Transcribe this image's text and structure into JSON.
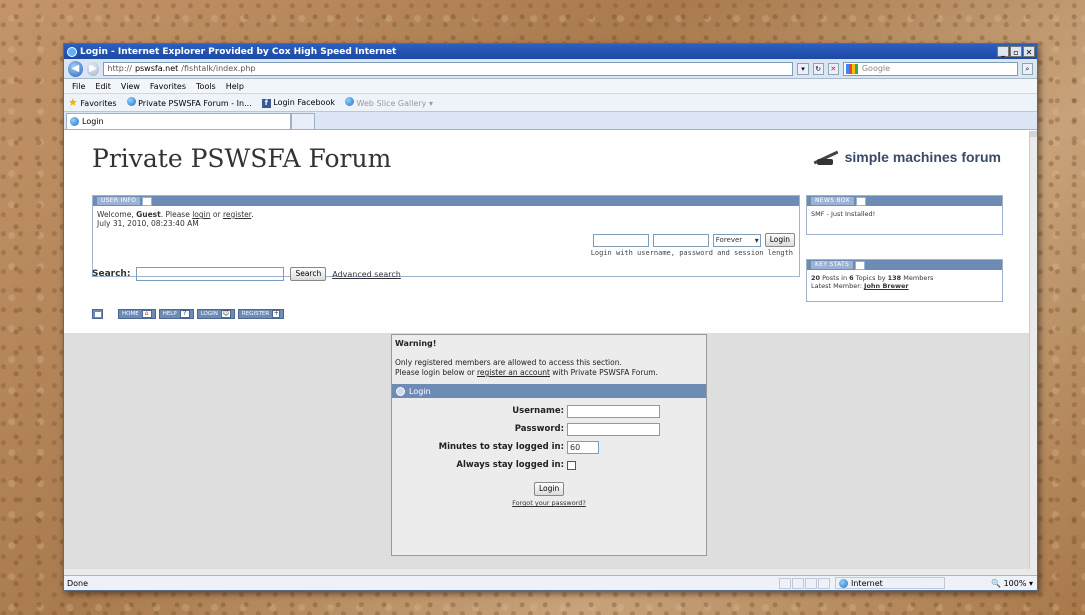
{
  "browser": {
    "title": "Login - Internet Explorer Provided by Cox High Speed Internet",
    "url_prefix": "http://",
    "url_host": "pswsfa.net",
    "url_path": "/fishtalk/index.php",
    "search_placeholder": "Google",
    "menu": [
      "File",
      "Edit",
      "View",
      "Favorites",
      "Tools",
      "Help"
    ],
    "favorites_label": "Favorites",
    "fav_links": [
      "Private PSWSFA Forum - In...",
      "Login Facebook",
      "Web Slice Gallery"
    ],
    "tab_title": "Login",
    "status_text": "Done",
    "zone": "Internet",
    "zoom": "100%"
  },
  "forum": {
    "title": "Private PSWSFA Forum",
    "logo_text": "simple machines forum",
    "user_info_label": "USER INFO",
    "welcome_prefix": "Welcome, ",
    "guest": "Guest",
    "welcome_mid": ". Please ",
    "login_link": "login",
    "or": " or ",
    "register_link": "register",
    "period": ".",
    "datetime": "July 31, 2010, 08:23:40 AM",
    "forever_option": "Forever",
    "login_button": "Login",
    "login_hint": "Login with username, password and session length",
    "search_label": "Search:",
    "search_button": "Search",
    "advanced_search": "Advanced search",
    "nav": [
      "HOME",
      "HELP",
      "LOGIN",
      "REGISTER"
    ],
    "news_label": "NEWS BOX",
    "news_text": "SMF - Just Installed!",
    "stats_label": "KEY STATS",
    "stats_posts": "20",
    "stats_t1": " Posts in ",
    "stats_topics": "6",
    "stats_t2": " Topics by ",
    "stats_members": "138",
    "stats_t3": " Members",
    "latest_member_label": "Latest Member: ",
    "latest_member": "John Brewer"
  },
  "login_box": {
    "warning_title": "Warning!",
    "warning_line1": "Only registered members are allowed to access this section.",
    "warning_line2a": "Please login below or ",
    "register_account": "register an account",
    "warning_line2b": " with Private PSWSFA Forum.",
    "header": "Login",
    "username_label": "Username:",
    "password_label": "Password:",
    "minutes_label": "Minutes to stay logged in:",
    "minutes_value": "60",
    "always_label": "Always stay logged in:",
    "submit": "Login",
    "forgot": "Forgot your password?"
  }
}
